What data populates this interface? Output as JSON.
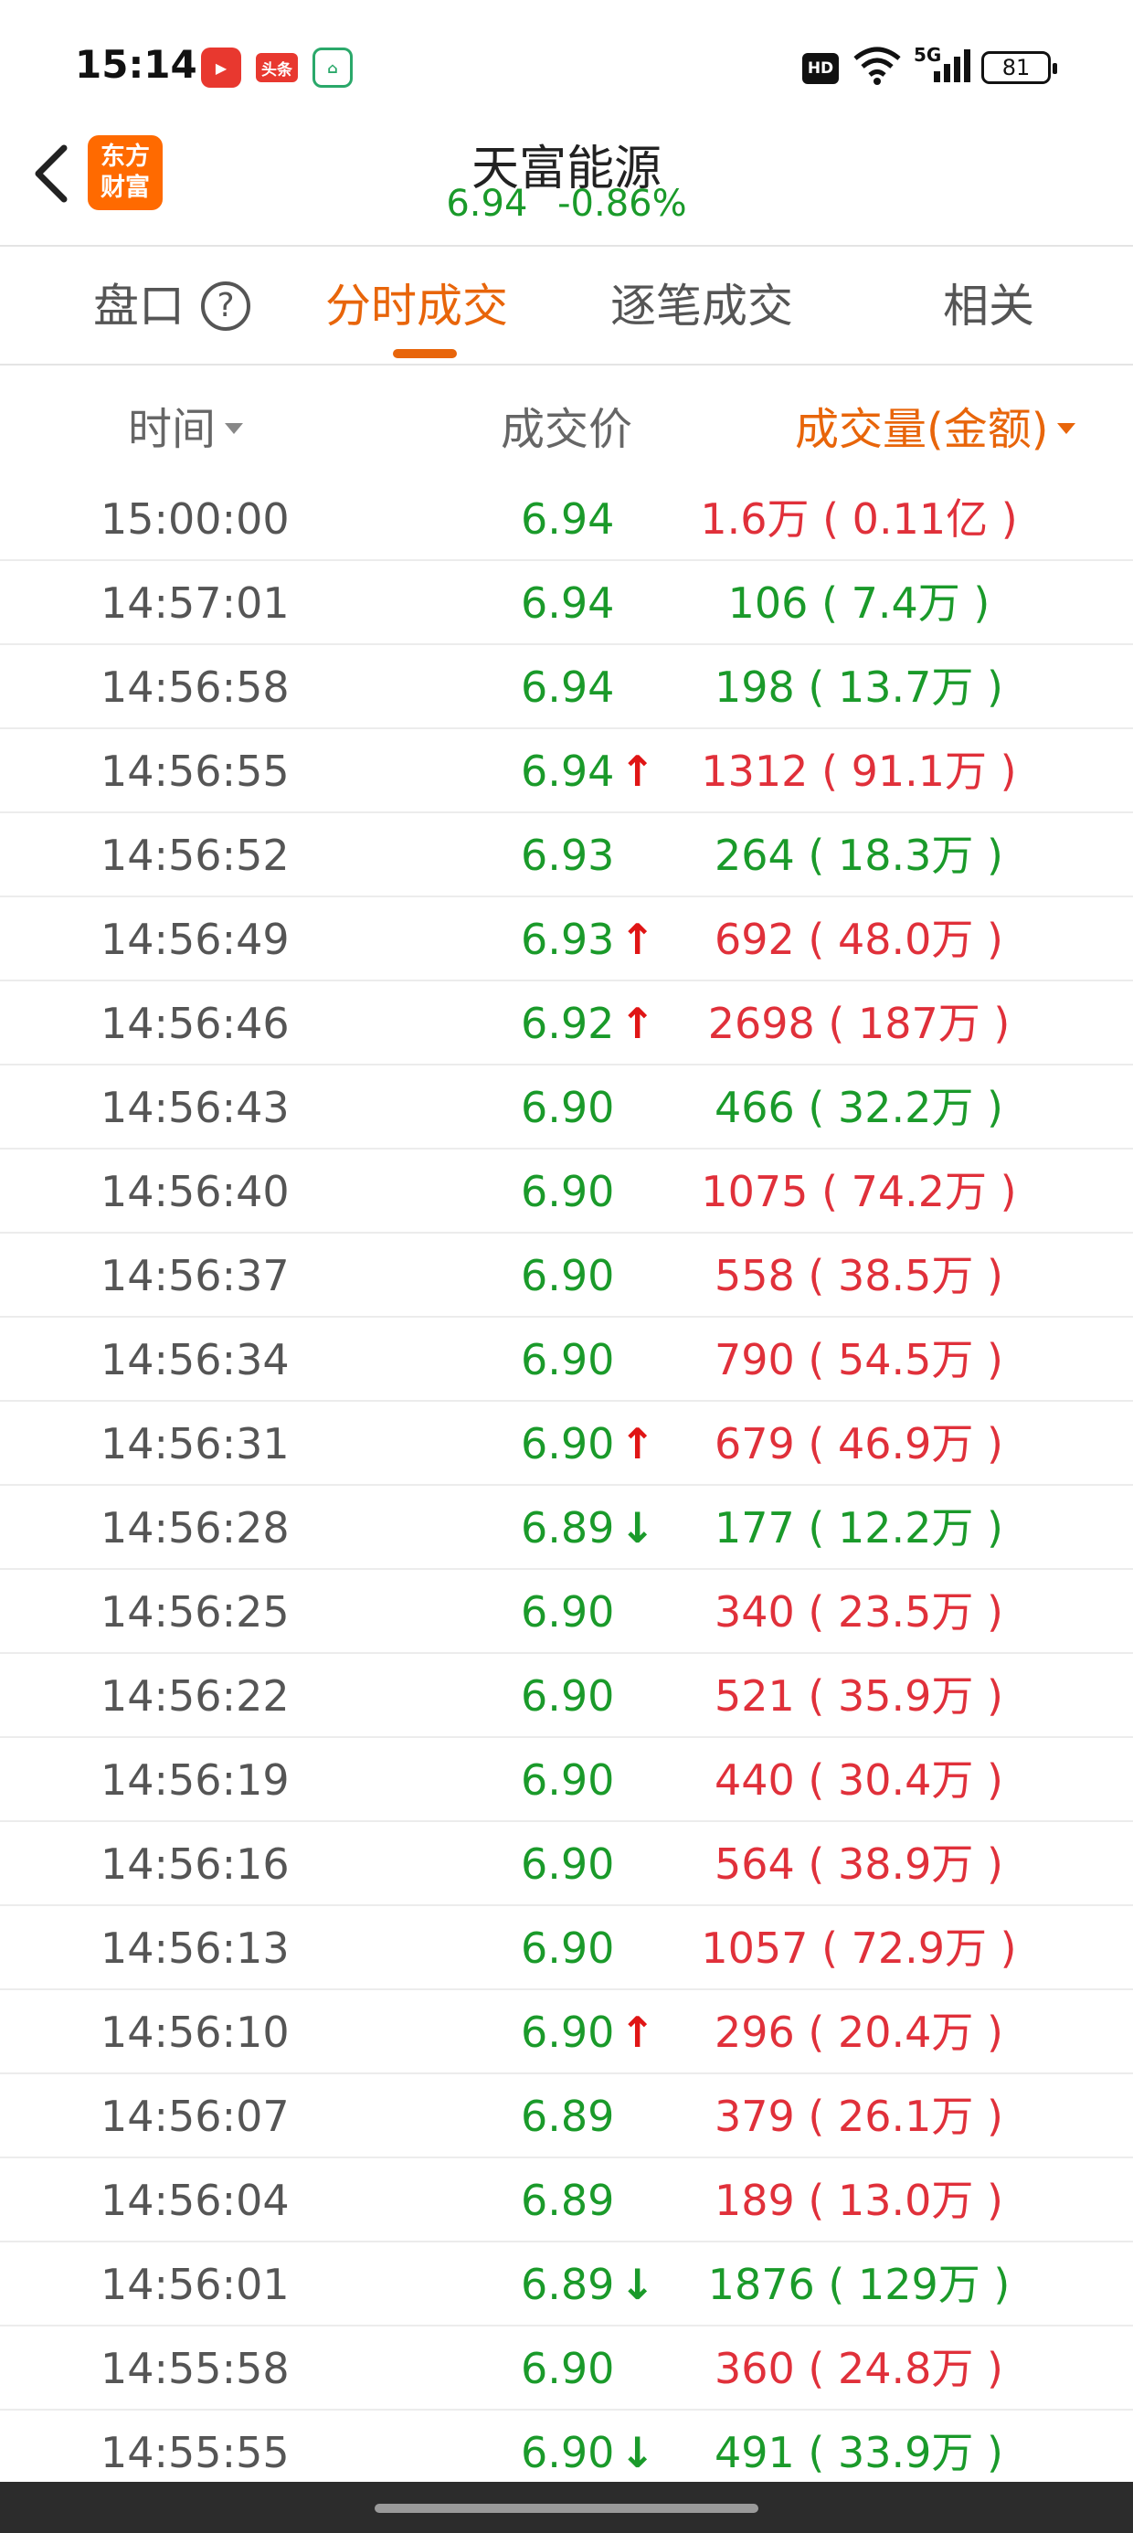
{
  "status_bar": {
    "time": "15:14",
    "app_icons": [
      "video-app-icon",
      "toutiao-icon",
      "home-app-icon"
    ],
    "toutiao_label": "头条",
    "hd_label": "HD",
    "network_label": "5G",
    "battery": "81"
  },
  "header": {
    "logo_line1": "东方",
    "logo_line2": "财富",
    "stock_name": "天富能源",
    "price": "6.94",
    "change_pct": "-0.86%"
  },
  "tabs": [
    {
      "label": "盘口",
      "active": false
    },
    {
      "label": "分时成交",
      "active": true
    },
    {
      "label": "逐笔成交",
      "active": false
    },
    {
      "label": "相关",
      "active": false
    }
  ],
  "columns": {
    "time": "时间",
    "price": "成交价",
    "volume": "成交量(金额)"
  },
  "colors": {
    "accent": "#e8650a",
    "up": "#e0303a",
    "down": "#1a9a2a"
  },
  "trades": [
    {
      "time": "15:00:00",
      "price": "6.94",
      "arrow": "",
      "volume": "1.6万 ( 0.11亿 )",
      "vol_color": "red"
    },
    {
      "time": "14:57:01",
      "price": "6.94",
      "arrow": "",
      "volume": "106 ( 7.4万 )",
      "vol_color": "green"
    },
    {
      "time": "14:56:58",
      "price": "6.94",
      "arrow": "",
      "volume": "198 ( 13.7万 )",
      "vol_color": "green"
    },
    {
      "time": "14:56:55",
      "price": "6.94",
      "arrow": "up",
      "volume": "1312 ( 91.1万 )",
      "vol_color": "red"
    },
    {
      "time": "14:56:52",
      "price": "6.93",
      "arrow": "",
      "volume": "264 ( 18.3万 )",
      "vol_color": "green"
    },
    {
      "time": "14:56:49",
      "price": "6.93",
      "arrow": "up",
      "volume": "692 ( 48.0万 )",
      "vol_color": "red"
    },
    {
      "time": "14:56:46",
      "price": "6.92",
      "arrow": "up",
      "volume": "2698 ( 187万 )",
      "vol_color": "red"
    },
    {
      "time": "14:56:43",
      "price": "6.90",
      "arrow": "",
      "volume": "466 ( 32.2万 )",
      "vol_color": "green"
    },
    {
      "time": "14:56:40",
      "price": "6.90",
      "arrow": "",
      "volume": "1075 ( 74.2万 )",
      "vol_color": "red"
    },
    {
      "time": "14:56:37",
      "price": "6.90",
      "arrow": "",
      "volume": "558 ( 38.5万 )",
      "vol_color": "red"
    },
    {
      "time": "14:56:34",
      "price": "6.90",
      "arrow": "",
      "volume": "790 ( 54.5万 )",
      "vol_color": "red"
    },
    {
      "time": "14:56:31",
      "price": "6.90",
      "arrow": "up",
      "volume": "679 ( 46.9万 )",
      "vol_color": "red"
    },
    {
      "time": "14:56:28",
      "price": "6.89",
      "arrow": "down",
      "volume": "177 ( 12.2万 )",
      "vol_color": "green"
    },
    {
      "time": "14:56:25",
      "price": "6.90",
      "arrow": "",
      "volume": "340 ( 23.5万 )",
      "vol_color": "red"
    },
    {
      "time": "14:56:22",
      "price": "6.90",
      "arrow": "",
      "volume": "521 ( 35.9万 )",
      "vol_color": "red"
    },
    {
      "time": "14:56:19",
      "price": "6.90",
      "arrow": "",
      "volume": "440 ( 30.4万 )",
      "vol_color": "red"
    },
    {
      "time": "14:56:16",
      "price": "6.90",
      "arrow": "",
      "volume": "564 ( 38.9万 )",
      "vol_color": "red"
    },
    {
      "time": "14:56:13",
      "price": "6.90",
      "arrow": "",
      "volume": "1057 ( 72.9万 )",
      "vol_color": "red"
    },
    {
      "time": "14:56:10",
      "price": "6.90",
      "arrow": "up",
      "volume": "296 ( 20.4万 )",
      "vol_color": "red"
    },
    {
      "time": "14:56:07",
      "price": "6.89",
      "arrow": "",
      "volume": "379 ( 26.1万 )",
      "vol_color": "red"
    },
    {
      "time": "14:56:04",
      "price": "6.89",
      "arrow": "",
      "volume": "189 ( 13.0万 )",
      "vol_color": "red"
    },
    {
      "time": "14:56:01",
      "price": "6.89",
      "arrow": "down",
      "volume": "1876 ( 129万 )",
      "vol_color": "green"
    },
    {
      "time": "14:55:58",
      "price": "6.90",
      "arrow": "",
      "volume": "360 ( 24.8万 )",
      "vol_color": "red"
    },
    {
      "time": "14:55:55",
      "price": "6.90",
      "arrow": "down",
      "volume": "491 ( 33.9万 )",
      "vol_color": "green"
    }
  ]
}
